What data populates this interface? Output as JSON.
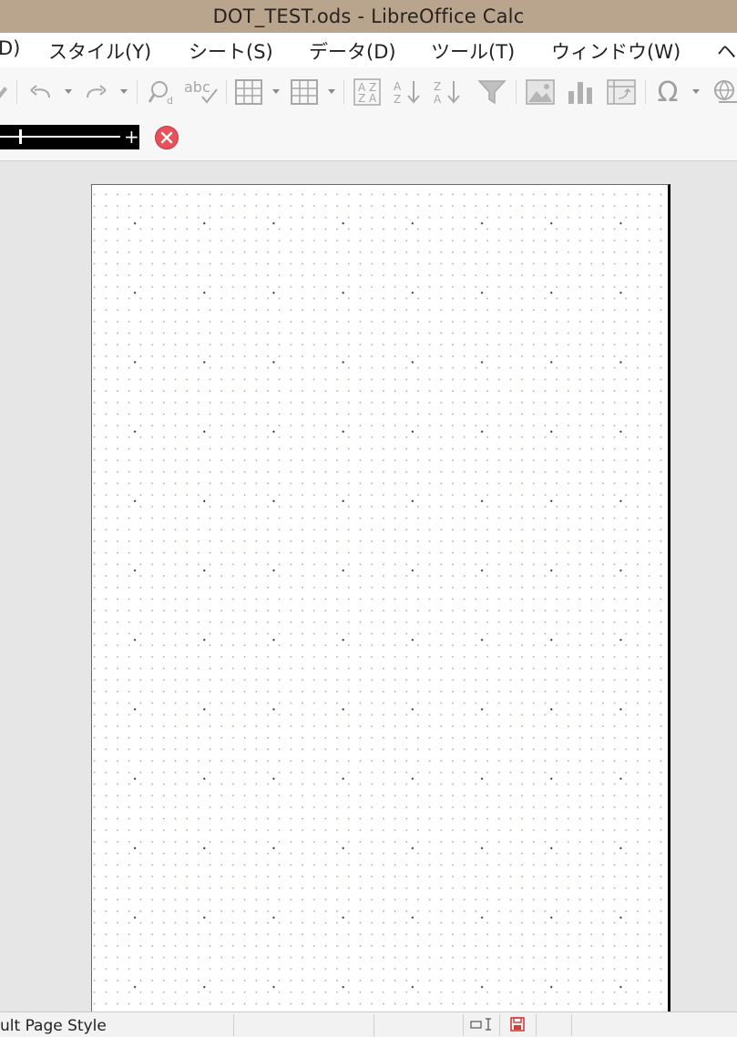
{
  "window": {
    "title": "DOT_TEST.ods - LibreOffice Calc"
  },
  "menubar": {
    "items": [
      {
        "label": "D)"
      },
      {
        "label": "スタイル(Y)"
      },
      {
        "label": "シート(S)"
      },
      {
        "label": "データ(D)"
      },
      {
        "label": "ツール(T)"
      },
      {
        "label": "ウィンドウ(W)"
      },
      {
        "label": "ヘ"
      }
    ]
  },
  "toolbar": {
    "spellcheck_label": "abc",
    "sort_ascending_label": "A Z",
    "sort_descending_label": "Z A",
    "omega": "Ω"
  },
  "zoom": {
    "plus": "+"
  },
  "statusbar": {
    "page_style": "ult Page Style"
  },
  "colors": {
    "titlebar": "#b9a48e",
    "close_red": "#e8505a",
    "save_red": "#d43c3c"
  }
}
